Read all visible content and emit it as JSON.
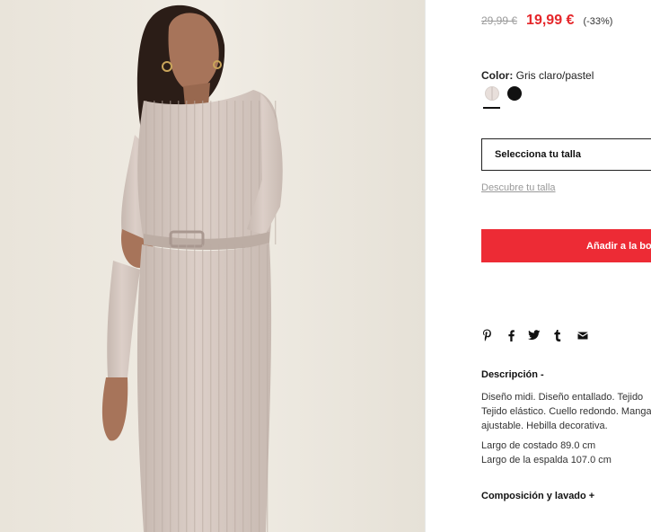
{
  "product": {
    "image_alt": "Modelo con vestido midi de punto canalé color gris claro/pastel",
    "price": {
      "old": "29,99 €",
      "current": "19,99 €",
      "discount": "(-33%)"
    },
    "color": {
      "label": "Color:",
      "selected": "Gris claro/pastel",
      "swatches": [
        {
          "name": "Gris claro/pastel",
          "hex": "#e8dfdb",
          "selected": true
        },
        {
          "name": "Negro",
          "hex": "#111111",
          "selected": false
        }
      ]
    },
    "size": {
      "select_label": "Selecciona tu talla",
      "guide_link": "Descubre tu talla"
    },
    "add_to_bag": "Añadir a la bolsa",
    "share_icons": [
      "pinterest-icon",
      "facebook-icon",
      "twitter-icon",
      "tumblr-icon",
      "email-icon"
    ],
    "description": {
      "title": "Descripción -",
      "lines": [
        "Diseño midi. Diseño entallado. Tejido",
        "Tejido elástico. Cuello redondo. Mangas",
        "ajustable. Hebilla decorativa."
      ],
      "measures": [
        "Largo de costado 89.0 cm",
        "Largo de la espalda 107.0 cm"
      ]
    },
    "composition_title": "Composición y lavado  +"
  },
  "colors": {
    "accent": "#ed2b35",
    "sale_price": "#e5262a",
    "old_price": "#9b9b9b",
    "link": "#999999"
  }
}
